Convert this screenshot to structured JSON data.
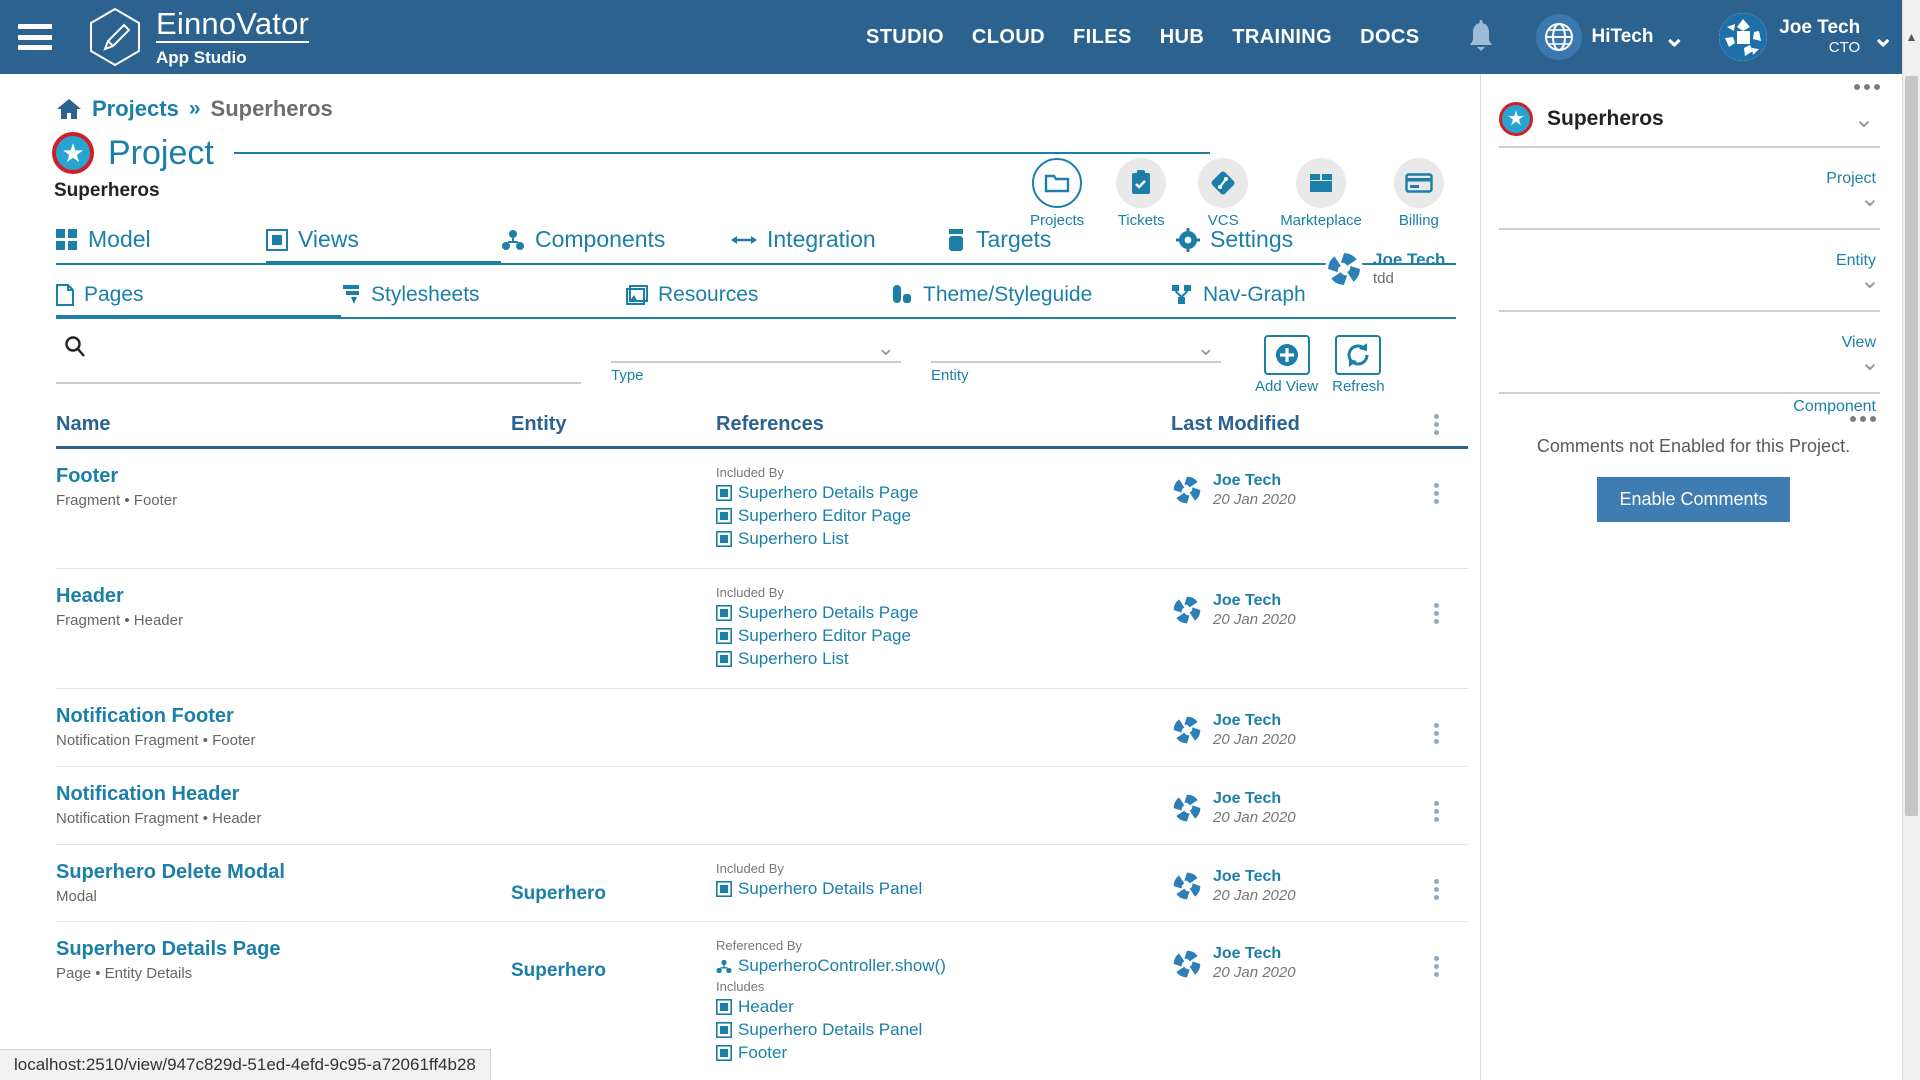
{
  "topnav": {
    "menu_icon": "hamburger-icon",
    "brand": "EinnoVator",
    "brand_sub": "App Studio",
    "links": [
      "STUDIO",
      "CLOUD",
      "FILES",
      "HUB",
      "TRAINING",
      "DOCS"
    ],
    "notification_icon": "bell-icon",
    "org": {
      "name": "HiTech",
      "icon": "globe-icon"
    },
    "user": {
      "name": "Joe Tech",
      "role": "CTO",
      "avatar": "user-avatar"
    }
  },
  "breadcrumb": {
    "home_icon": "home-icon",
    "root": "Projects",
    "separator": "»",
    "current": "Superheros"
  },
  "header": {
    "title": "Project",
    "subtitle": "Superheros",
    "owner": {
      "name": "Joe Tech",
      "handle": "tdd"
    }
  },
  "quicktools": [
    {
      "label": "Projects",
      "icon": "folder-icon",
      "active": true
    },
    {
      "label": "Tickets",
      "icon": "clipboard-check-icon",
      "active": false
    },
    {
      "label": "VCS",
      "icon": "git-branch-icon",
      "active": false
    },
    {
      "label": "Markteplace",
      "icon": "box-icon",
      "active": false
    },
    {
      "label": "Billing",
      "icon": "credit-card-icon",
      "active": false
    }
  ],
  "tabs": [
    {
      "label": "Model",
      "icon": "grid-icon",
      "active": false
    },
    {
      "label": "Views",
      "icon": "window-icon",
      "active": true
    },
    {
      "label": "Components",
      "icon": "components-icon",
      "active": false
    },
    {
      "label": "Integration",
      "icon": "arrows-icon",
      "active": false
    },
    {
      "label": "Targets",
      "icon": "target-icon",
      "active": false
    },
    {
      "label": "Settings",
      "icon": "gear-icon",
      "active": false
    }
  ],
  "subtabs": [
    {
      "label": "Pages",
      "icon": "page-icon",
      "active": true
    },
    {
      "label": "Stylesheets",
      "icon": "stylesheet-icon",
      "active": false
    },
    {
      "label": "Resources",
      "icon": "image-icon",
      "active": false
    },
    {
      "label": "Theme/Styleguide",
      "icon": "theme-icon",
      "active": false
    },
    {
      "label": "Nav-Graph",
      "icon": "nav-graph-icon",
      "active": false
    }
  ],
  "filterbar": {
    "search_value": "",
    "search_placeholder": "",
    "search_icon": "search-icon",
    "type_label": "Type",
    "type_value": "",
    "entity_label": "Entity",
    "entity_value": "",
    "add_view_label": "Add View",
    "refresh_label": "Refresh"
  },
  "table": {
    "columns": [
      "Name",
      "Entity",
      "References",
      "Last Modified"
    ],
    "rows": [
      {
        "name": "Footer",
        "sub": "Fragment • Footer",
        "entity": "",
        "refgroups": [
          {
            "label": "Included By",
            "items": [
              "Superhero Details Page",
              "Superhero Editor Page",
              "Superhero List"
            ],
            "icon": "view-icon"
          }
        ],
        "modified_by": "Joe Tech",
        "modified_date": "20 Jan 2020"
      },
      {
        "name": "Header",
        "sub": "Fragment • Header",
        "entity": "",
        "refgroups": [
          {
            "label": "Included By",
            "items": [
              "Superhero Details Page",
              "Superhero Editor Page",
              "Superhero List"
            ],
            "icon": "view-icon"
          }
        ],
        "modified_by": "Joe Tech",
        "modified_date": "20 Jan 2020"
      },
      {
        "name": "Notification Footer",
        "sub": "Notification Fragment • Footer",
        "entity": "",
        "refgroups": [],
        "modified_by": "Joe Tech",
        "modified_date": "20 Jan 2020"
      },
      {
        "name": "Notification Header",
        "sub": "Notification Fragment • Header",
        "entity": "",
        "refgroups": [],
        "modified_by": "Joe Tech",
        "modified_date": "20 Jan 2020"
      },
      {
        "name": "Superhero Delete Modal",
        "sub": "Modal",
        "entity": "Superhero",
        "refgroups": [
          {
            "label": "Included By",
            "items": [
              "Superhero Details Panel"
            ],
            "icon": "view-icon"
          }
        ],
        "modified_by": "Joe Tech",
        "modified_date": "20 Jan 2020"
      },
      {
        "name": "Superhero Details Page",
        "sub": "Page • Entity Details",
        "entity": "Superhero",
        "refgroups": [
          {
            "label": "Referenced By",
            "items": [
              "SuperheroController.show()"
            ],
            "icon": "controller-icon"
          },
          {
            "label": "Includes",
            "items": [
              "Header",
              "Superhero Details Panel",
              "Footer"
            ],
            "icon": "view-icon"
          }
        ],
        "modified_by": "Joe Tech",
        "modified_date": "20 Jan 2020"
      }
    ]
  },
  "rightpanel": {
    "project_title": "Superheros",
    "fields": [
      {
        "label": "Project",
        "value": ""
      },
      {
        "label": "Entity",
        "value": ""
      },
      {
        "label": "View",
        "value": ""
      },
      {
        "label": "Component",
        "value": ""
      }
    ],
    "comments_text": "Comments not Enabled for this Project.",
    "enable_comments_label": "Enable Comments"
  },
  "statusbar": {
    "url": "localhost:2510/view/947c829d-51ed-4efd-9c95-a72061ff4b28"
  },
  "colors": {
    "navy": "#2c628f",
    "teal": "#1b7fa8",
    "accent_red": "#d02027",
    "accent_cyan": "#29a3cf",
    "button_blue": "#3e7cb1"
  }
}
